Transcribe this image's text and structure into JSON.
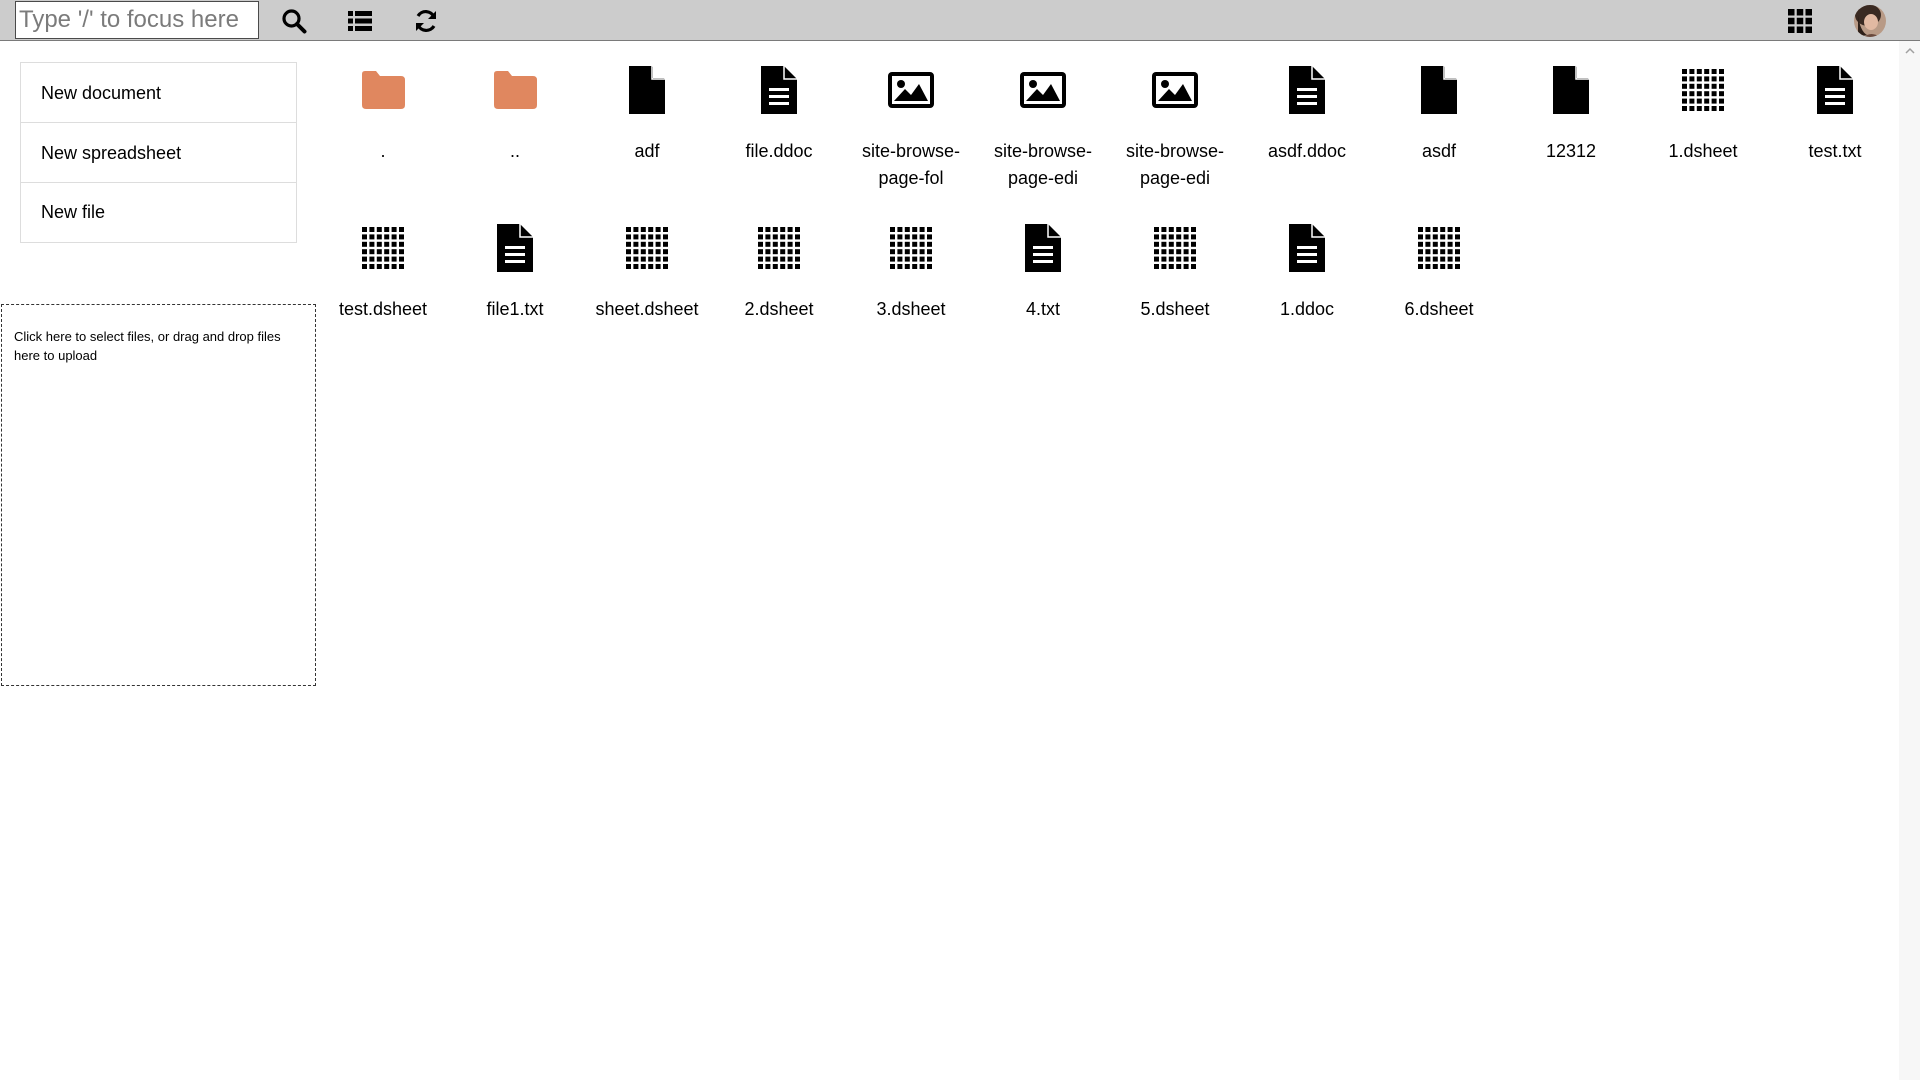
{
  "search": {
    "placeholder": "Type '/' to focus here",
    "value": ""
  },
  "toolbar": {
    "search_icon": "search-icon",
    "list_view_icon": "list-icon",
    "refresh_icon": "refresh-icon",
    "apps_icon": "apps-grid-icon"
  },
  "actions": [
    {
      "label": "New document"
    },
    {
      "label": "New spreadsheet"
    },
    {
      "label": "New file"
    }
  ],
  "upload": {
    "text": "Click here to select files, or drag and drop files here to upload"
  },
  "colors": {
    "folder": "#e0875f",
    "topbar": "#cccccc",
    "icon": "#000000"
  },
  "files": [
    {
      "name": ".",
      "icon": "folder-icon"
    },
    {
      "name": "..",
      "icon": "folder-icon"
    },
    {
      "name": "adf",
      "icon": "file-icon"
    },
    {
      "name": "file.ddoc",
      "icon": "document-icon"
    },
    {
      "name": "site-browse-page-fol",
      "icon": "image-icon"
    },
    {
      "name": "site-browse-page-edi",
      "icon": "image-icon"
    },
    {
      "name": "site-browse-page-edi",
      "icon": "image-icon"
    },
    {
      "name": "asdf.ddoc",
      "icon": "document-icon"
    },
    {
      "name": "asdf",
      "icon": "file-icon"
    },
    {
      "name": "12312",
      "icon": "file-icon"
    },
    {
      "name": "1.dsheet",
      "icon": "spreadsheet-icon"
    },
    {
      "name": "test.txt",
      "icon": "document-icon"
    },
    {
      "name": "test.dsheet",
      "icon": "spreadsheet-icon"
    },
    {
      "name": "file1.txt",
      "icon": "document-icon"
    },
    {
      "name": "sheet.dsheet",
      "icon": "spreadsheet-icon"
    },
    {
      "name": "2.dsheet",
      "icon": "spreadsheet-icon"
    },
    {
      "name": "3.dsheet",
      "icon": "spreadsheet-icon"
    },
    {
      "name": "4.txt",
      "icon": "document-icon"
    },
    {
      "name": "5.dsheet",
      "icon": "spreadsheet-icon"
    },
    {
      "name": "1.ddoc",
      "icon": "document-icon"
    },
    {
      "name": "6.dsheet",
      "icon": "spreadsheet-icon"
    }
  ]
}
